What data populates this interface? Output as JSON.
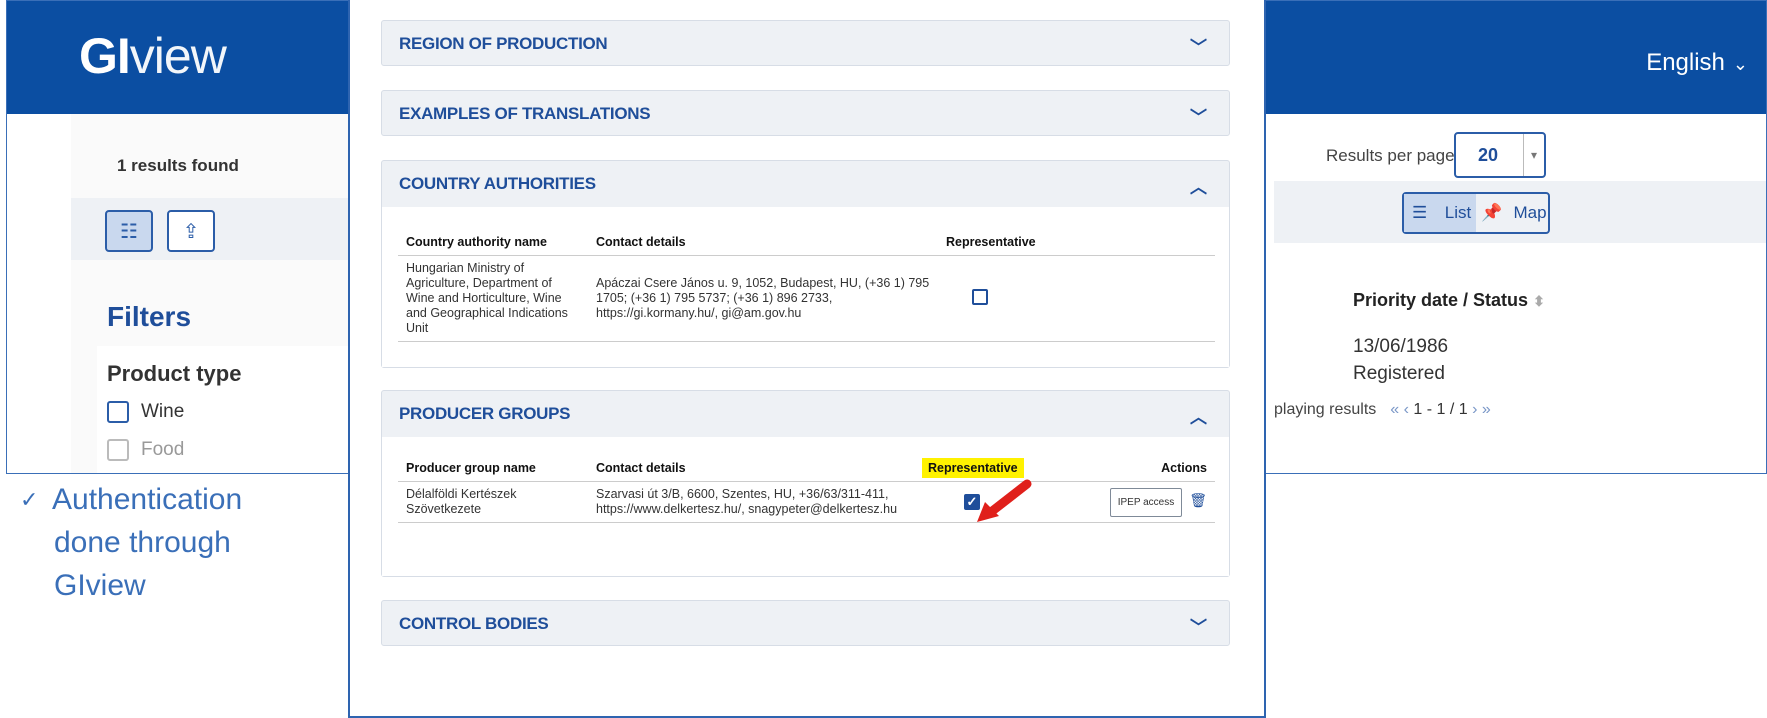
{
  "background_app": {
    "logo_bold": "GI",
    "logo_rest": "view",
    "language": "English",
    "results_found": "1 results found",
    "filters_title": "Filters",
    "product_type_label": "Product type",
    "product_type_options": [
      "Wine",
      "Food"
    ],
    "results_per_page_label": "Results per page",
    "results_per_page_value": "20",
    "view_list_label": "List",
    "view_map_label": "Map",
    "priority_column_header": "Priority date / Status",
    "priority_date": "13/06/1986",
    "status": "Registered",
    "pager_text": "playing results",
    "pager_nav": "1 - 1 / 1"
  },
  "modal": {
    "sections": [
      {
        "title": "REGION OF PRODUCTION",
        "expanded": false
      },
      {
        "title": "EXAMPLES OF TRANSLATIONS",
        "expanded": false
      },
      {
        "title": "COUNTRY AUTHORITIES",
        "expanded": true
      },
      {
        "title": "PRODUCER GROUPS",
        "expanded": true
      },
      {
        "title": "CONTROL BODIES",
        "expanded": false
      }
    ],
    "country_authorities": {
      "headers": [
        "Country authority name",
        "Contact details",
        "Representative"
      ],
      "rows": [
        {
          "name": "Hungarian Ministry of Agriculture, Department of Wine and Horticulture, Wine and Geographical Indications Unit",
          "contact": "Apáczai Csere János u. 9, 1052, Budapest, HU, (+36 1) 795 1705; (+36 1) 795 5737; (+36 1) 896 2733, https://gi.kormany.hu/, gi@am.gov.hu",
          "representative": false
        }
      ]
    },
    "producer_groups": {
      "headers": [
        "Producer group name",
        "Contact details",
        "Representative",
        "Actions"
      ],
      "rows": [
        {
          "name": "Délalföldi Kertészek Szövetkezete",
          "contact": "Szarvasi út 3/B, 6600, Szentes, HU, +36/63/311-411, https://www.delkertesz.hu/, snagypeter@delkertesz.hu",
          "representative": true,
          "action_label": "IPEP access"
        }
      ]
    }
  },
  "annotation": {
    "text_lines": [
      "Authentication",
      "done through",
      "GIview"
    ],
    "highlight_color": "#fff200",
    "arrow_color": "#e0201b"
  }
}
